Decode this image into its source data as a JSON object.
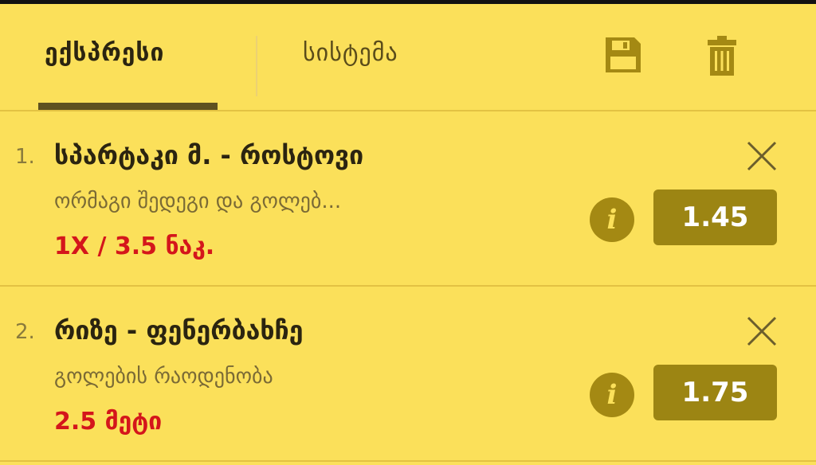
{
  "tabs": {
    "express": "ექსპრესი",
    "system": "სისტემა"
  },
  "icons": {
    "save": "save-icon",
    "delete": "trash-icon",
    "close": "close-icon",
    "info": "info-icon"
  },
  "colors": {
    "background": "#fbe05a",
    "accent": "#9c8513",
    "pick": "#d4161b"
  },
  "bets": [
    {
      "index": "1.",
      "match": "სპარტაკი მ. - როსტოვი",
      "market": "ორმაგი შედეგი და გოლებ...",
      "pick": "1X / 3.5 ნაკ.",
      "odds": "1.45",
      "info_label": "i"
    },
    {
      "index": "2.",
      "match": "რიზე - ფენერბახჩე",
      "market": "გოლების რაოდენობა",
      "pick": "2.5 მეტი",
      "odds": "1.75",
      "info_label": "i"
    }
  ]
}
